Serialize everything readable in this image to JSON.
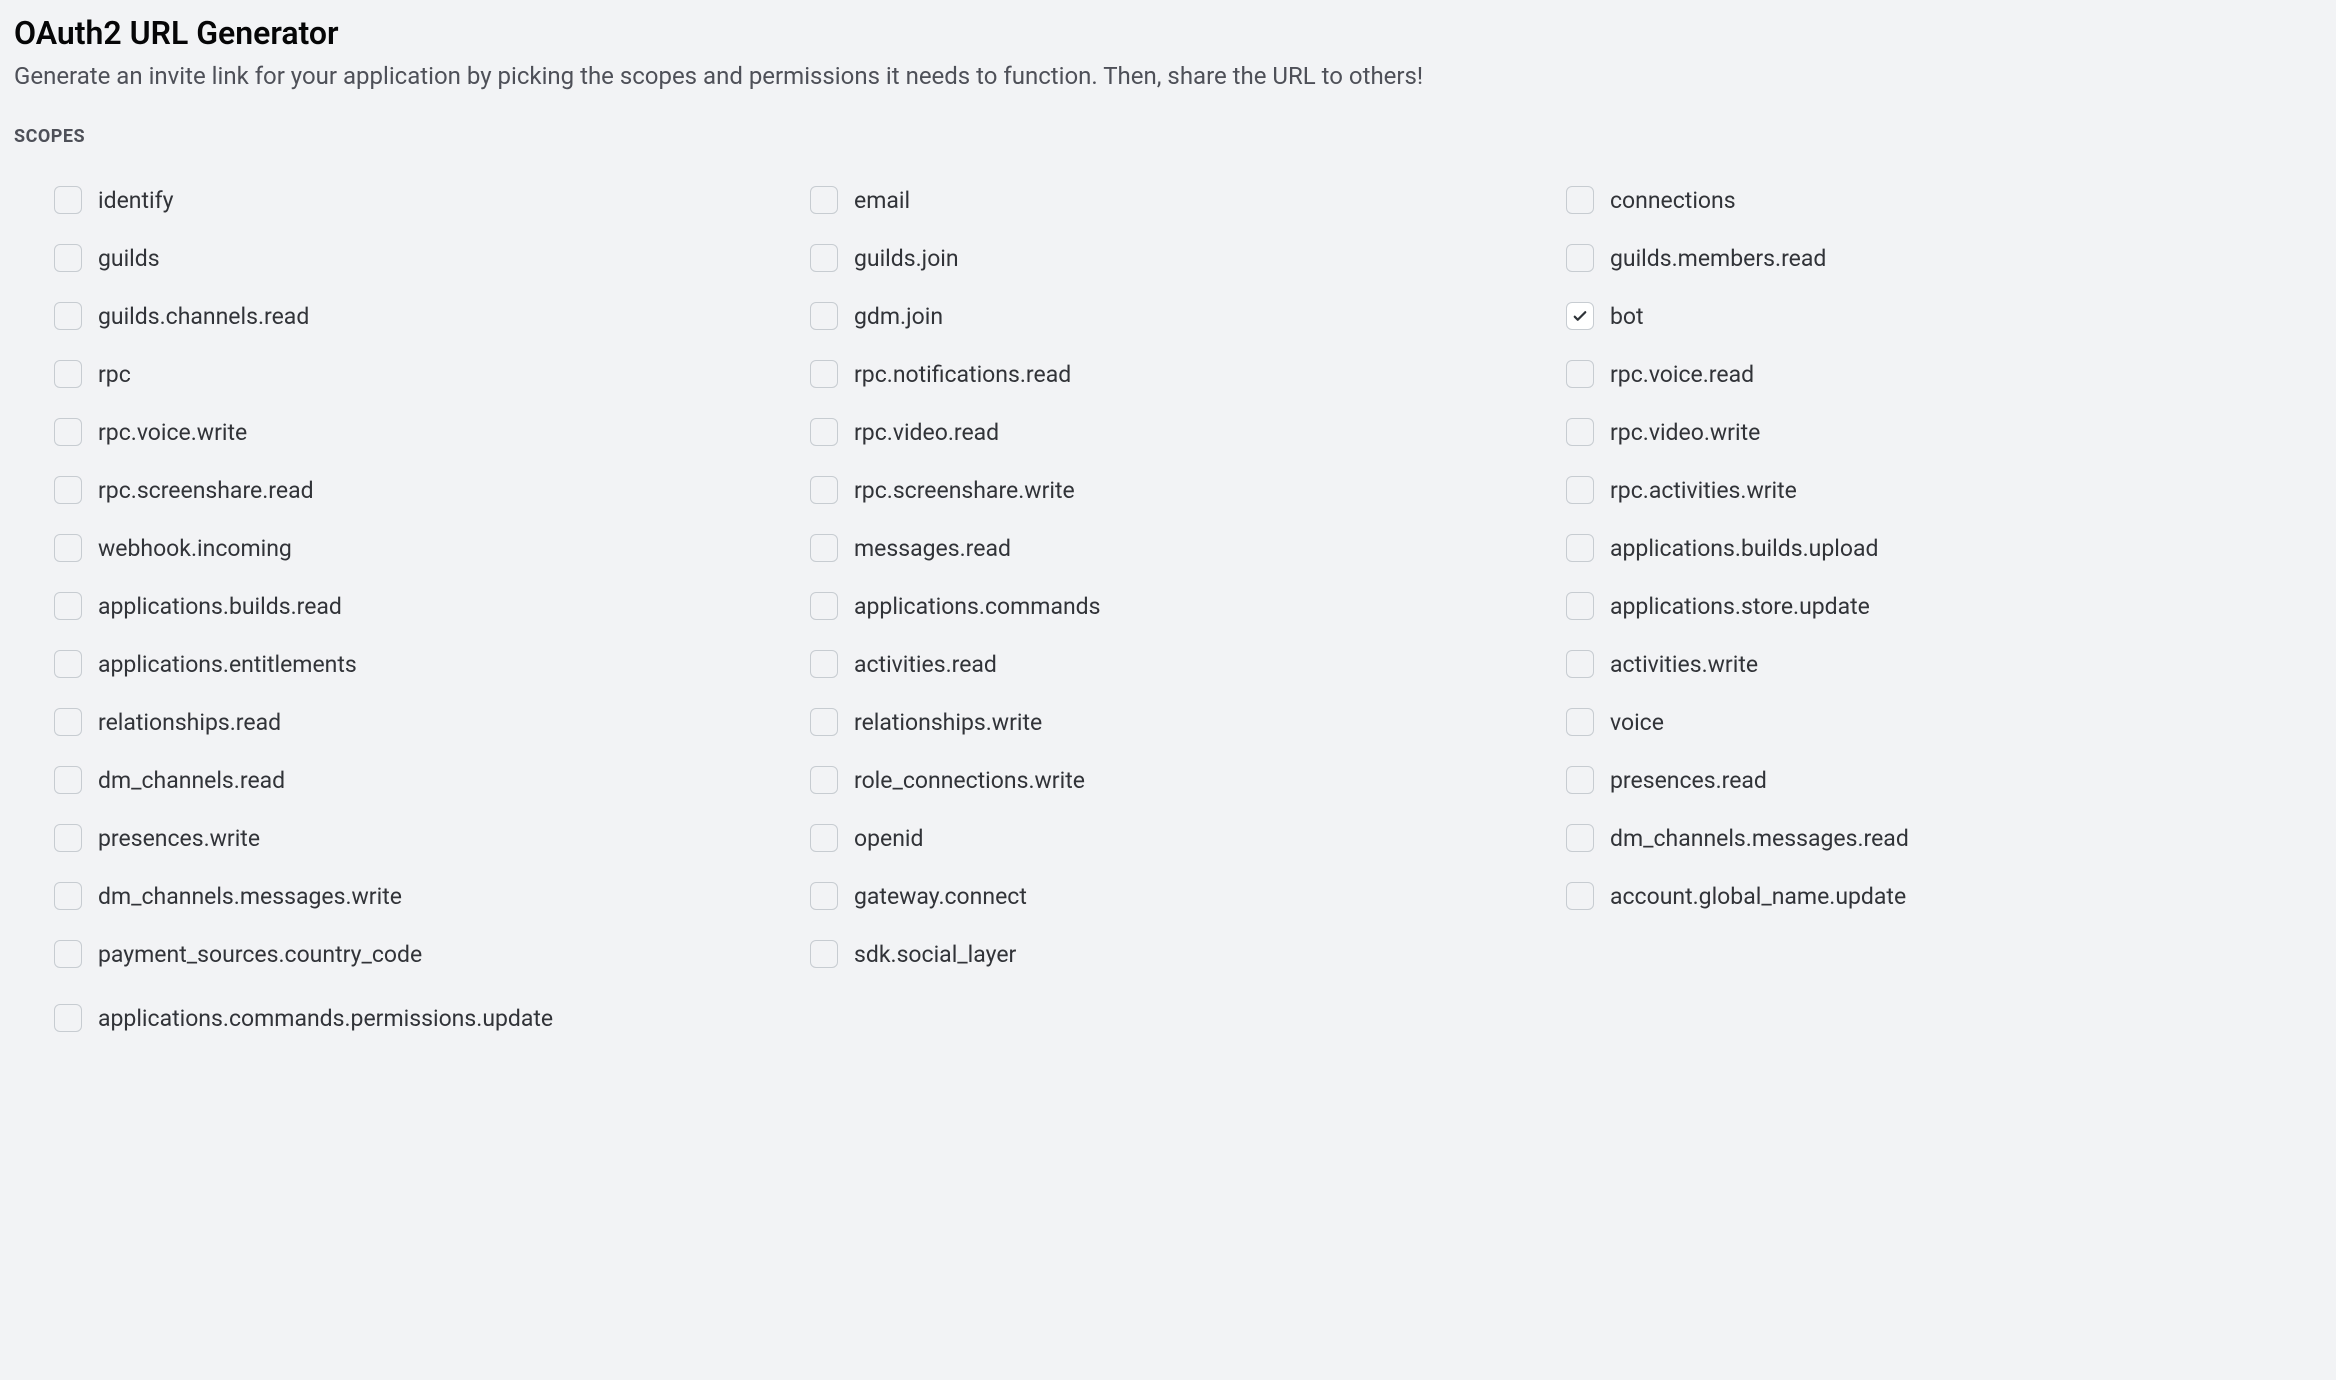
{
  "heading": "OAuth2 URL Generator",
  "description": "Generate an invite link for your application by picking the scopes and permissions it needs to function. Then, share the URL to others!",
  "sectionLabel": "SCOPES",
  "scopes": {
    "col1": [
      {
        "label": "identify",
        "checked": false
      },
      {
        "label": "guilds",
        "checked": false
      },
      {
        "label": "guilds.channels.read",
        "checked": false
      },
      {
        "label": "rpc",
        "checked": false
      },
      {
        "label": "rpc.voice.write",
        "checked": false
      },
      {
        "label": "rpc.screenshare.read",
        "checked": false
      },
      {
        "label": "webhook.incoming",
        "checked": false
      },
      {
        "label": "applications.builds.read",
        "checked": false
      },
      {
        "label": "applications.entitlements",
        "checked": false
      },
      {
        "label": "relationships.read",
        "checked": false
      },
      {
        "label": "dm_channels.read",
        "checked": false
      },
      {
        "label": "presences.write",
        "checked": false
      },
      {
        "label": "dm_channels.messages.write",
        "checked": false
      },
      {
        "label": "payment_sources.country_code",
        "checked": false
      }
    ],
    "col2": [
      {
        "label": "email",
        "checked": false
      },
      {
        "label": "guilds.join",
        "checked": false
      },
      {
        "label": "gdm.join",
        "checked": false
      },
      {
        "label": "rpc.notifications.read",
        "checked": false
      },
      {
        "label": "rpc.video.read",
        "checked": false
      },
      {
        "label": "rpc.screenshare.write",
        "checked": false
      },
      {
        "label": "messages.read",
        "checked": false
      },
      {
        "label": "applications.commands",
        "checked": false
      },
      {
        "label": "activities.read",
        "checked": false
      },
      {
        "label": "relationships.write",
        "checked": false
      },
      {
        "label": "role_connections.write",
        "checked": false
      },
      {
        "label": "openid",
        "checked": false
      },
      {
        "label": "gateway.connect",
        "checked": false
      },
      {
        "label": "sdk.social_layer",
        "checked": false
      }
    ],
    "col3": [
      {
        "label": "connections",
        "checked": false
      },
      {
        "label": "guilds.members.read",
        "checked": false
      },
      {
        "label": "bot",
        "checked": true
      },
      {
        "label": "rpc.voice.read",
        "checked": false
      },
      {
        "label": "rpc.video.write",
        "checked": false
      },
      {
        "label": "rpc.activities.write",
        "checked": false
      },
      {
        "label": "applications.builds.upload",
        "checked": false
      },
      {
        "label": "applications.store.update",
        "checked": false
      },
      {
        "label": "activities.write",
        "checked": false
      },
      {
        "label": "voice",
        "checked": false
      },
      {
        "label": "presences.read",
        "checked": false
      },
      {
        "label": "dm_channels.messages.read",
        "checked": false
      },
      {
        "label": "account.global_name.update",
        "checked": false
      }
    ],
    "fullRow": [
      {
        "label": "applications.commands.permissions.update",
        "checked": false
      }
    ]
  }
}
